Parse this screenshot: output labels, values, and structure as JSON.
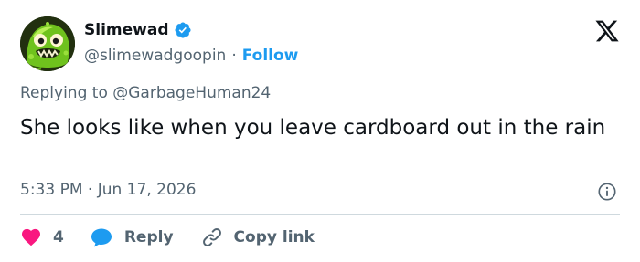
{
  "author": {
    "display_name": "Slimewad",
    "handle": "@slimewadgoopin",
    "separator": "·",
    "follow_label": "Follow",
    "avatar_icon": "slime-monster-avatar",
    "verified_icon": "verified-badge-icon"
  },
  "tweet": {
    "replying_prefix": "Replying to",
    "replying_to": "@GarbageHuman24",
    "text": "She looks like when you leave cardboard out in the rain",
    "time": "5:33 PM",
    "meta_separator": "·",
    "date": "Jun 17, 2026"
  },
  "actions": {
    "like_count": "4",
    "reply_label": "Reply",
    "copy_link_label": "Copy link"
  },
  "icons": {
    "brand": "x-logo-icon",
    "info": "info-icon",
    "like": "heart-icon",
    "reply": "speech-bubble-icon",
    "copy": "link-icon"
  },
  "colors": {
    "text_primary": "#0f1419",
    "text_secondary": "#536471",
    "accent": "#1d9bf0",
    "like": "#f91880",
    "divider": "#cfd9de"
  }
}
